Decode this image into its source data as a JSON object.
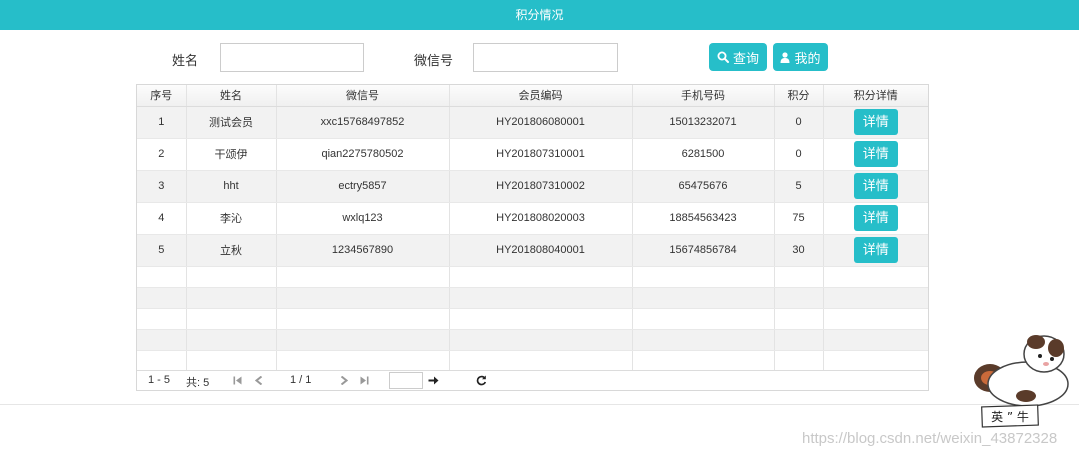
{
  "header": {
    "title": "积分情况"
  },
  "search": {
    "name_label": "姓名",
    "name_value": "",
    "wechat_label": "微信号",
    "wechat_value": "",
    "query_label": "查询",
    "mine_label": "我的"
  },
  "table": {
    "columns": [
      "序号",
      "姓名",
      "微信号",
      "会员编码",
      "手机号码",
      "积分",
      "积分详情"
    ],
    "rows": [
      {
        "no": "1",
        "name": "测试会员",
        "wechat": "xxc15768497852",
        "code": "HY201806080001",
        "phone": "15013232071",
        "points": "0",
        "detail": "详情"
      },
      {
        "no": "2",
        "name": "干颂伊",
        "wechat": "qian2275780502",
        "code": "HY201807310001",
        "phone": "6281500",
        "points": "0",
        "detail": "详情"
      },
      {
        "no": "3",
        "name": "hht",
        "wechat": "ectry5857",
        "code": "HY201807310002",
        "phone": "65475676",
        "points": "5",
        "detail": "详情"
      },
      {
        "no": "4",
        "name": "李沁",
        "wechat": "wxlq123",
        "code": "HY201808020003",
        "phone": "18854563423",
        "points": "75",
        "detail": "详情"
      },
      {
        "no": "5",
        "name": "立秋",
        "wechat": "1234567890",
        "code": "HY201808040001",
        "phone": "15674856784",
        "points": "30",
        "detail": "详情"
      }
    ]
  },
  "pager": {
    "range": "1 - 5",
    "total": "共: 5",
    "page": "1 / 1",
    "goto_value": ""
  },
  "watermark": "https://blog.csdn.net/weixin_43872328",
  "mascot_text": "英 ” 牛",
  "colors": {
    "accent": "#26bec9",
    "row_alt": "#f2f2f2"
  },
  "icons": [
    "search-icon",
    "user-icon",
    "first-page-icon",
    "prev-page-icon",
    "next-page-icon",
    "last-page-icon",
    "go-arrow-icon",
    "refresh-icon"
  ]
}
